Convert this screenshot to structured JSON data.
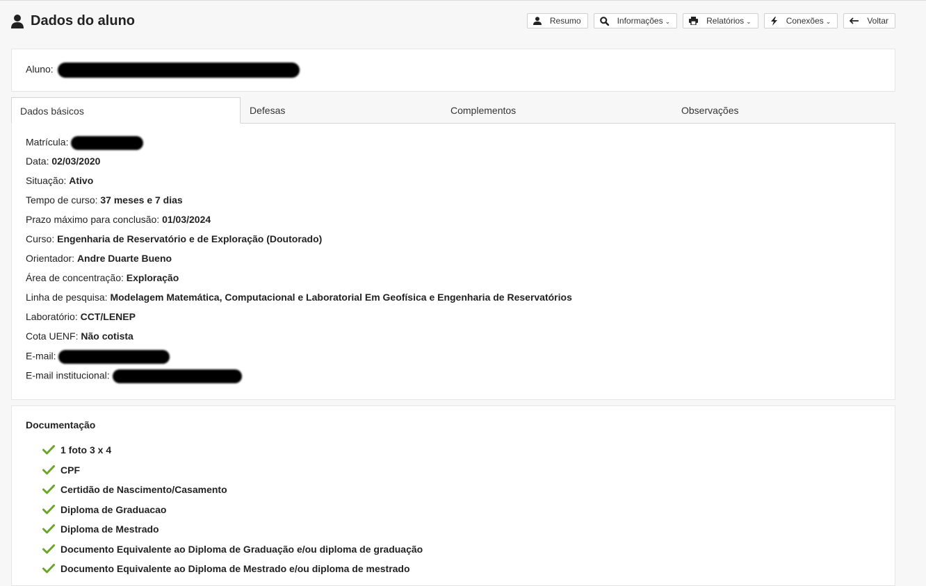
{
  "page": {
    "title": "Dados do aluno"
  },
  "toolbar": {
    "resumo": "Resumo",
    "informacoes": "Informações",
    "relatorios": "Relatórios",
    "conexoes": "Conexões",
    "voltar": "Voltar",
    "caret": "⌄"
  },
  "student": {
    "label": "Aluno:"
  },
  "tabs": [
    "Dados básicos",
    "Defesas",
    "Complementos",
    "Observações"
  ],
  "details": {
    "matricula_label": "Matrícula:",
    "data_label": "Data:",
    "data_value": "02/03/2020",
    "situacao_label": "Situação:",
    "situacao_value": "Ativo",
    "tempo_label": "Tempo de curso:",
    "tempo_value": "37 meses e 7 dias",
    "prazo_label": "Prazo máximo para conclusão:",
    "prazo_value": "01/03/2024",
    "curso_label": "Curso:",
    "curso_value": "Engenharia de Reservatório e de Exploração (Doutorado)",
    "orientador_label": "Orientador:",
    "orientador_value": "Andre Duarte Bueno",
    "area_label": "Área de concentração:",
    "area_value": "Exploração",
    "linha_label": "Linha de pesquisa:",
    "linha_value": "Modelagem Matemática, Computacional e Laboratorial Em Geofísica e Engenharia de Reservatórios",
    "lab_label": "Laboratório:",
    "lab_value": "CCT/LENEP",
    "cota_label": "Cota UENF:",
    "cota_value": "Não cotista",
    "email_label": "E-mail:",
    "email_inst_label": "E-mail institucional:"
  },
  "documentation": {
    "title": "Documentação",
    "items": [
      "1 foto 3 x 4",
      "CPF",
      "Certidão de Nascimento/Casamento",
      "Diploma de Graduacao",
      "Diploma de Mestrado",
      "Documento Equivalente ao Diploma de Graduação e/ou diploma de graduação",
      "Documento Equivalente ao Diploma de Mestrado e/ou diploma de mestrado"
    ]
  },
  "colors": {
    "check": "#6aa52a",
    "text": "#222222"
  }
}
